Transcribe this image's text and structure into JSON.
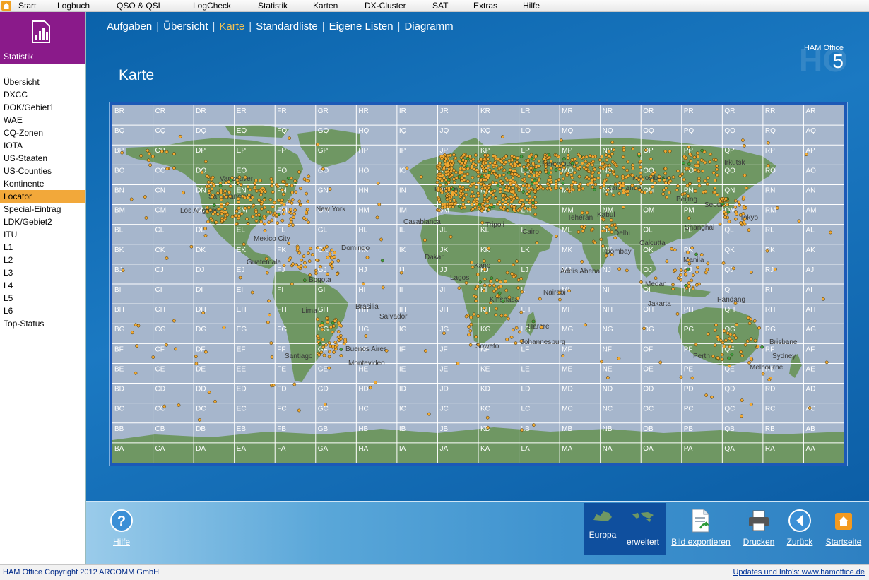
{
  "menubar": {
    "items": [
      "Start",
      "Logbuch",
      "QSO & QSL",
      "LogCheck",
      "Statistik",
      "Karten",
      "DX-Cluster",
      "SAT",
      "Extras",
      "Hilfe"
    ]
  },
  "sidebar": {
    "header": "Statistik",
    "items": [
      "Übersicht",
      "DXCC",
      "DOK/Gebiet1",
      "WAE",
      "CQ-Zonen",
      "IOTA",
      "US-Staaten",
      "US-Counties",
      "Kontinente",
      "Locator",
      "Special-Eintrag",
      "LDK/Gebiet2",
      "ITU",
      "L1",
      "L2",
      "L3",
      "L4",
      "L5",
      "L6",
      "Top-Status"
    ],
    "selected": "Locator"
  },
  "tabs": {
    "items": [
      "Aufgaben",
      "Übersicht",
      "Karte",
      "Standardliste",
      "Eigene Listen",
      "Diagramm"
    ],
    "active": "Karte"
  },
  "page_title": "Karte",
  "brand": {
    "watermark": "HO",
    "name": "HAM Office",
    "version": "5"
  },
  "map": {
    "columns": [
      "BR",
      "CR",
      "DR",
      "ER",
      "FR",
      "GR",
      "HR",
      "IR",
      "JR",
      "KR",
      "LR",
      "MR",
      "NR",
      "OR",
      "PR",
      "QR",
      "RR",
      "AR"
    ],
    "row_letters": [
      "R",
      "Q",
      "P",
      "O",
      "N",
      "M",
      "L",
      "K",
      "J",
      "I",
      "H",
      "G",
      "F",
      "E",
      "D",
      "C",
      "B",
      "A"
    ],
    "city_labels": [
      "Vancouver",
      "Los Angeles",
      "San Francisco",
      "New York",
      "Mexico City",
      "Guatemala",
      "Domingo",
      "Bogota",
      "Lima",
      "Brasilia",
      "Salvador",
      "Santiago",
      "Buenos Aires",
      "Montevideo",
      "Casablanca",
      "Dakar",
      "Lagos",
      "Kano",
      "Tripoli",
      "Cairo",
      "Kinshasa",
      "Nairobi",
      "Addis Abeba",
      "Harare",
      "Soweto",
      "Johannesburg",
      "London",
      "Petersburg",
      "Karaganda",
      "Novosibirsk",
      "Irkutsk",
      "Teheran",
      "Kabul",
      "Delhi",
      "Bombay",
      "Calcutta",
      "Beijing",
      "Seoul",
      "Tokyo",
      "Shanghai",
      "Manila",
      "Medan",
      "Jakarta",
      "Pandang",
      "Perth",
      "Brisbane",
      "Sydney",
      "Melbourne"
    ],
    "colors": {
      "ocean": "#a6b6cc",
      "land": "#6f9763",
      "grid": "#ffffff",
      "marker": "#f3aa33",
      "marker_worked": "#3aa040",
      "frame": "#1c59b6"
    }
  },
  "toolbar": {
    "help": "Hilfe",
    "europa": "Europa",
    "erweitert": "erweitert",
    "export": "Bild exportieren",
    "print": "Drucken",
    "back": "Zurück",
    "home": "Startseite"
  },
  "status": {
    "copyright": "HAM Office Copyright 2012 ARCOMM GmbH",
    "link": "Updates und Info's: www.hamoffice.de"
  }
}
